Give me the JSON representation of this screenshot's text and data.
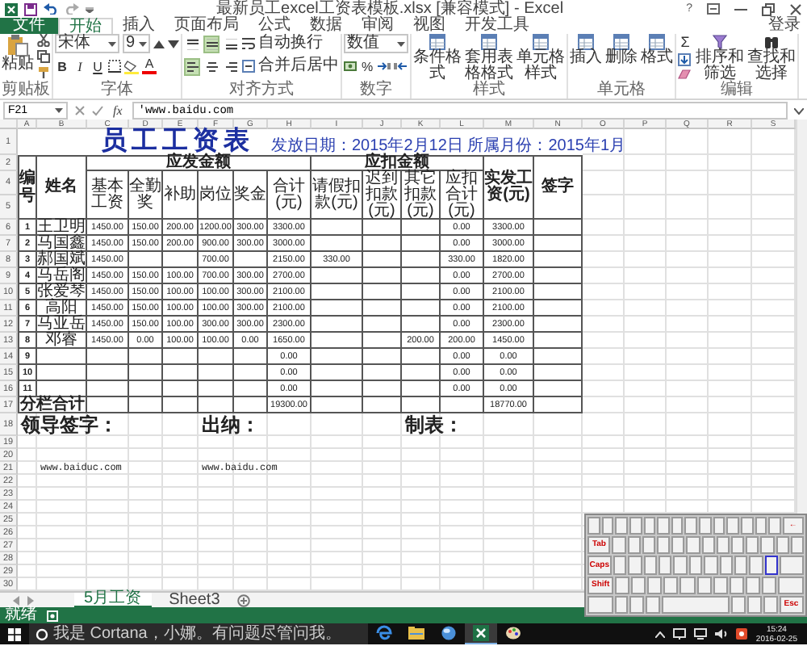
{
  "window": {
    "title": "最新员工excel工资表模板.xlsx [兼容模式] - Excel",
    "help": "?"
  },
  "ribbon_tabs": [
    {
      "label": "文件",
      "kind": "file",
      "selected": false
    },
    {
      "label": "开始",
      "kind": "tab",
      "selected": true
    },
    {
      "label": "插入",
      "kind": "tab",
      "selected": false
    },
    {
      "label": "页面布局",
      "kind": "tab",
      "selected": false
    },
    {
      "label": "公式",
      "kind": "tab",
      "selected": false
    },
    {
      "label": "数据",
      "kind": "tab",
      "selected": false
    },
    {
      "label": "审阅",
      "kind": "tab",
      "selected": false
    },
    {
      "label": "视图",
      "kind": "tab",
      "selected": false
    },
    {
      "label": "开发工具",
      "kind": "tab",
      "selected": false
    }
  ],
  "account": "登录",
  "ribbon_groups": [
    {
      "kind": "clipboard",
      "label": "剪贴板",
      "paste": "粘贴"
    },
    {
      "kind": "font",
      "label": "字体",
      "font": "宋体",
      "size": "9",
      "styles": [
        "B",
        "I",
        "U"
      ],
      "font_color": "A"
    },
    {
      "kind": "alignment",
      "label": "对齐方式",
      "vertical": [
        {
          "kind": "top",
          "selected": false
        },
        {
          "kind": "middle",
          "selected": true
        },
        {
          "kind": "bottom",
          "selected": false
        }
      ],
      "horizontal": [
        {
          "kind": "left",
          "selected": true
        },
        {
          "kind": "center",
          "selected": false
        },
        {
          "kind": "right",
          "selected": false
        }
      ],
      "wrap": "自动换行",
      "merge": "合并后居中"
    },
    {
      "kind": "number",
      "label": "数字",
      "format": "数值",
      "percent": "%"
    },
    {
      "kind": "buttons",
      "label": "样式",
      "buttons": [
        "条件格式",
        "套用表格格式",
        "单元格样式"
      ]
    },
    {
      "kind": "buttons",
      "label": "单元格",
      "buttons": [
        "插入",
        "删除",
        "格式"
      ]
    },
    {
      "kind": "editing",
      "label": "编辑",
      "sum": "Σ",
      "buttons": [
        "排序和筛选",
        "查找和选择"
      ]
    }
  ],
  "formula_bar": {
    "name_box": "F21",
    "function_label": "fx",
    "value": "'www.baidu.com"
  },
  "sheet": {
    "columns": [
      "A",
      "B",
      "C",
      "D",
      "E",
      "F",
      "G",
      "H",
      "I",
      "J",
      "K",
      "L",
      "M",
      "N",
      "O",
      "P",
      "Q",
      "R",
      "S"
    ],
    "rows": [
      {
        "number": "1",
        "kind": "title",
        "cells": {
          "C": "员工工资表",
          "H": "发放日期：2015年2月12日 所属月份：2015年1月"
        }
      },
      {
        "number": "2",
        "kind": "group_header",
        "cells": {
          "A": "编号",
          "B": "姓名",
          "C": "应发金额",
          "I": "应扣金额",
          "M": "实发工资(元)",
          "N": "签字"
        }
      },
      {
        "number": "4",
        "kind": "subheader",
        "cells": {
          "C": "基本工资",
          "D": "全勤奖",
          "E": "补助",
          "F": "岗位",
          "G": "奖金",
          "H": "合计(元)",
          "I": "请假扣款(元)",
          "J": "迟到扣款(元)",
          "K": "其它扣款(元)",
          "L": "应扣合计(元)"
        }
      },
      {
        "number": "5",
        "kind": "header_rest"
      },
      {
        "number": "6",
        "kind": "data",
        "cells": {
          "A": "1",
          "B": "王卫明",
          "C": "1450.00",
          "D": "150.00",
          "E": "200.00",
          "F": "1200.00",
          "G": "300.00",
          "H": "3300.00",
          "L": "0.00",
          "M": "3300.00"
        }
      },
      {
        "number": "7",
        "kind": "data",
        "cells": {
          "A": "2",
          "B": "马国鑫",
          "C": "1450.00",
          "D": "150.00",
          "E": "200.00",
          "F": "900.00",
          "G": "300.00",
          "H": "3000.00",
          "L": "0.00",
          "M": "3000.00"
        }
      },
      {
        "number": "8",
        "kind": "data",
        "cells": {
          "A": "3",
          "B": "郝国斌",
          "C": "1450.00",
          "F": "700.00",
          "H": "2150.00",
          "I": "330.00",
          "L": "330.00",
          "M": "1820.00"
        }
      },
      {
        "number": "9",
        "kind": "data",
        "cells": {
          "A": "4",
          "B": "马岳阁",
          "C": "1450.00",
          "D": "150.00",
          "E": "100.00",
          "F": "700.00",
          "G": "300.00",
          "H": "2700.00",
          "L": "0.00",
          "M": "2700.00"
        }
      },
      {
        "number": "10",
        "kind": "data",
        "cells": {
          "A": "5",
          "B": "张爱琴",
          "C": "1450.00",
          "D": "150.00",
          "E": "100.00",
          "F": "100.00",
          "G": "300.00",
          "H": "2100.00",
          "L": "0.00",
          "M": "2100.00"
        }
      },
      {
        "number": "11",
        "kind": "data",
        "cells": {
          "A": "6",
          "B": "高阳",
          "C": "1450.00",
          "D": "150.00",
          "E": "100.00",
          "F": "100.00",
          "G": "300.00",
          "H": "2100.00",
          "L": "0.00",
          "M": "2100.00"
        }
      },
      {
        "number": "12",
        "kind": "data",
        "cells": {
          "A": "7",
          "B": "马亚岳",
          "C": "1450.00",
          "D": "150.00",
          "E": "100.00",
          "F": "300.00",
          "G": "300.00",
          "H": "2300.00",
          "L": "0.00",
          "M": "2300.00"
        }
      },
      {
        "number": "13",
        "kind": "data",
        "cells": {
          "A": "8",
          "B": "邓睿",
          "C": "1450.00",
          "D": "0.00",
          "E": "100.00",
          "F": "100.00",
          "G": "0.00",
          "H": "1650.00",
          "K": "200.00",
          "L": "200.00",
          "M": "1450.00"
        }
      },
      {
        "number": "14",
        "kind": "data",
        "cells": {
          "A": "9",
          "H": "0.00",
          "L": "0.00",
          "M": "0.00"
        }
      },
      {
        "number": "15",
        "kind": "data",
        "cells": {
          "A": "10",
          "H": "0.00",
          "L": "0.00",
          "M": "0.00"
        }
      },
      {
        "number": "16",
        "kind": "data",
        "cells": {
          "A": "11",
          "H": "0.00",
          "L": "0.00",
          "M": "0.00"
        }
      },
      {
        "number": "17",
        "kind": "total",
        "cells": {
          "A": "分栏合计",
          "H": "19300.00",
          "M": "18770.00"
        }
      },
      {
        "number": "18",
        "kind": "signature",
        "cells": {
          "A": "领导签字：",
          "F": "出纳：",
          "K": "制表："
        }
      },
      {
        "number": "19",
        "kind": "plain"
      },
      {
        "number": "20",
        "kind": "plain"
      },
      {
        "number": "21",
        "kind": "note",
        "cells": {
          "B": "www.baiduc.com",
          "F": "www.baidu.com"
        }
      },
      {
        "number": "22",
        "kind": "plain"
      },
      {
        "number": "23",
        "kind": "plain"
      },
      {
        "number": "24",
        "kind": "plain"
      },
      {
        "number": "25",
        "kind": "plain"
      },
      {
        "number": "26",
        "kind": "plain"
      },
      {
        "number": "27",
        "kind": "plain"
      },
      {
        "number": "28",
        "kind": "plain"
      },
      {
        "number": "29",
        "kind": "plain"
      },
      {
        "number": "30",
        "kind": "plain"
      }
    ]
  },
  "sheet_tabs": [
    {
      "label": "5月工资",
      "selected": true
    },
    {
      "label": "Sheet3",
      "selected": false
    }
  ],
  "status_bar": {
    "text": "就绪"
  },
  "keyboard": {
    "backspace": "←",
    "tab": "Tab",
    "caps": "Caps",
    "shift": "Shift",
    "escape": "Esc"
  },
  "taskbar": {
    "search_placeholder": "我是 Cortana，小娜。有问题尽管问我。",
    "apps": [
      {
        "kind": "edge",
        "selected": false
      },
      {
        "kind": "explorer",
        "selected": false
      },
      {
        "kind": "browser",
        "selected": false
      },
      {
        "kind": "excel",
        "selected": true
      },
      {
        "kind": "paint",
        "selected": false
      }
    ],
    "time": "15:24",
    "date": "2016-02-25"
  }
}
